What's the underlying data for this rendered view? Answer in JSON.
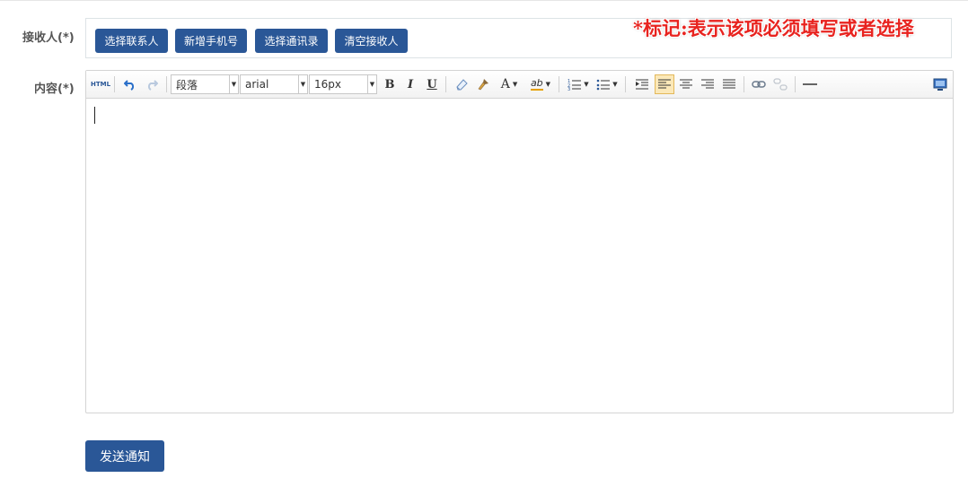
{
  "form": {
    "recipient_label": "接收人(*)",
    "content_label": "内容(*)"
  },
  "recipient_buttons": {
    "select_contact": "选择联系人",
    "add_phone": "新增手机号",
    "select_address_book": "选择通讯录",
    "clear_recipients": "清空接收人"
  },
  "required_note": "*标记:表示该项必须填写或者选择",
  "toolbar": {
    "html_label": "HTML",
    "paragraph_value": "段落",
    "font_family_value": "arial",
    "font_size_value": "16px",
    "bold_label": "B",
    "italic_label": "I",
    "underline_label": "U",
    "font_color_label": "A",
    "highlight_label": "ab",
    "active_alignment": "align-left"
  },
  "editor": {
    "content": ""
  },
  "send_button": "发送通知",
  "colors": {
    "primary": "#2a5797",
    "required_note": "#e8231f",
    "active_highlight": "#fbe8b8"
  }
}
